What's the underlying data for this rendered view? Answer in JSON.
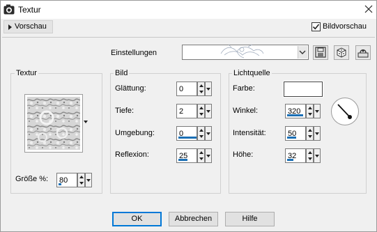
{
  "window": {
    "title": "Textur"
  },
  "toolbar": {
    "preview_label": "Vorschau",
    "bildvorschau_label": "Bildvorschau",
    "bildvorschau_checked": true
  },
  "settings": {
    "label": "Einstellungen",
    "preset_value": ""
  },
  "texture_group": {
    "label": "Textur",
    "size_label": "Größe %:",
    "size_value": "80",
    "size_level": 0.16
  },
  "image_group": {
    "label": "Bild",
    "fields": [
      {
        "label": "Glättung:",
        "value": "0",
        "level": 0
      },
      {
        "label": "Tiefe:",
        "value": "2",
        "level": 0
      },
      {
        "label": "Umgebung:",
        "value": "0",
        "level": 1.0
      },
      {
        "label": "Reflexion:",
        "value": "25",
        "level": 0.5
      }
    ]
  },
  "light_group": {
    "label": "Lichtquelle",
    "color_label": "Farbe:",
    "color_value": "#ffffff",
    "fields": [
      {
        "label": "Winkel:",
        "value": "320",
        "level": 0.89
      },
      {
        "label": "Intensität:",
        "value": "50",
        "level": 0.5
      },
      {
        "label": "Höhe:",
        "value": "32",
        "level": 0.36
      }
    ]
  },
  "buttons": {
    "ok": "OK",
    "cancel": "Abbrechen",
    "help": "Hilfe"
  },
  "icons": {
    "app": "camera-icon",
    "save": "save-icon",
    "random": "dice-icon",
    "reset": "reset-preset-icon"
  },
  "colors": {
    "accent": "#1a6fb5",
    "default_button_border": "#0078d7"
  }
}
